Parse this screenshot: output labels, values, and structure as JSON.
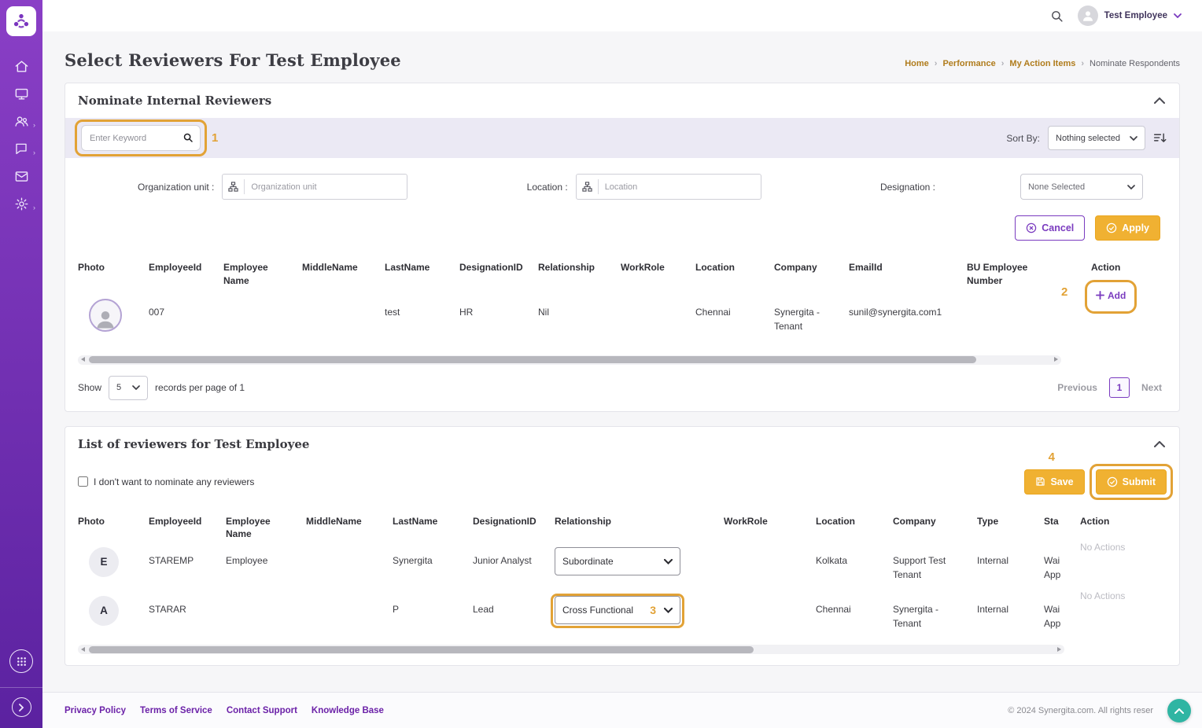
{
  "theme": {
    "brand_purple": "#7a3bbf",
    "sidebar_purple_top": "#8a3fc6",
    "sidebar_purple_bottom": "#5b22a0",
    "button_amber": "#f0b132",
    "annotation_amber": "#e2a236",
    "breadcrumb_link": "#b07c1c",
    "scrolltop_teal": "#2fb5a3",
    "band_lavender": "#ebe9f4"
  },
  "icons": {
    "topbar": [
      "search-icon",
      "user-avatar",
      "chevron-down-icon"
    ],
    "sidebar": [
      "synergita-logo-icon",
      "home-icon",
      "monitor-icon",
      "users-icon",
      "chat-icon",
      "mail-icon",
      "gear-icon",
      "apps-grid-icon",
      "chevron-right-icon"
    ],
    "buttons": [
      "x-circle-icon",
      "check-circle-icon",
      "save-floppy-icon",
      "plus-icon",
      "sort-order-icon",
      "org-hierarchy-icon",
      "chevron-up-icon"
    ]
  },
  "topbar": {
    "user_name": "Test Employee"
  },
  "page": {
    "title": "Select Reviewers For Test Employee",
    "breadcrumb": {
      "items": [
        "Home",
        "Performance",
        "My Action Items",
        "Nominate Respondents"
      ]
    }
  },
  "nominate": {
    "title": "Nominate Internal Reviewers",
    "search": {
      "placeholder": "Enter Keyword"
    },
    "sort": {
      "label": "Sort By:",
      "value": "Nothing selected"
    },
    "filters": {
      "org_label": "Organization unit :",
      "org_placeholder": "Organization unit",
      "loc_label": "Location :",
      "loc_placeholder": "Location",
      "desig_label": "Designation :",
      "desig_value": "None Selected"
    },
    "buttons": {
      "cancel": "Cancel",
      "apply": "Apply"
    },
    "table": {
      "columns": [
        "Photo",
        "EmployeeId",
        "Employee Name",
        "MiddleName",
        "LastName",
        "DesignationID",
        "Relationship",
        "WorkRole",
        "Location",
        "Company",
        "EmailId",
        "BU Employee Number",
        "Action"
      ],
      "row": {
        "employee_id": "007",
        "last_name": "test",
        "designation_id": "HR",
        "relationship": "Nil",
        "location": "Chennai",
        "company": "Synergita - Tenant",
        "email_id": "sunil@synergita.com1",
        "add_label": "Add"
      }
    },
    "pager": {
      "show": "Show",
      "per_page": "5",
      "records": "records per page of 1",
      "previous": "Previous",
      "page": "1",
      "next": "Next"
    }
  },
  "reviewers": {
    "title": "List of reviewers for Test Employee",
    "optout_label": "I don't want to nominate any reviewers",
    "buttons": {
      "save": "Save",
      "submit": "Submit"
    },
    "table": {
      "columns": [
        "Photo",
        "EmployeeId",
        "Employee Name",
        "MiddleName",
        "LastName",
        "DesignationID",
        "Relationship",
        "WorkRole",
        "Location",
        "Company",
        "Type",
        "Sta",
        "Action"
      ],
      "rows": [
        {
          "initial": "E",
          "employee_id": "STAREMP",
          "employee_name": "Employee",
          "last_name": "Synergita",
          "designation_id": "Junior Analyst",
          "relationship": "Subordinate",
          "location": "Kolkata",
          "company": "Support Test Tenant",
          "type": "Internal",
          "status_line1": "Wai",
          "status_line2": "App",
          "action": "No Actions"
        },
        {
          "initial": "A",
          "employee_id": "STARAR",
          "employee_name": "",
          "last_name": "P",
          "designation_id": "Lead",
          "relationship": "Cross Functional",
          "location": "Chennai",
          "company": "Synergita - Tenant",
          "type": "Internal",
          "status_line1": "Wai",
          "status_line2": "App",
          "action": "No Actions"
        }
      ]
    }
  },
  "annotations": {
    "n1": "1",
    "n2": "2",
    "n3": "3",
    "n4": "4"
  },
  "footer": {
    "links": [
      "Privacy Policy",
      "Terms of Service",
      "Contact Support",
      "Knowledge Base"
    ],
    "copyright": "© 2024 Synergita.com. All rights reser"
  }
}
